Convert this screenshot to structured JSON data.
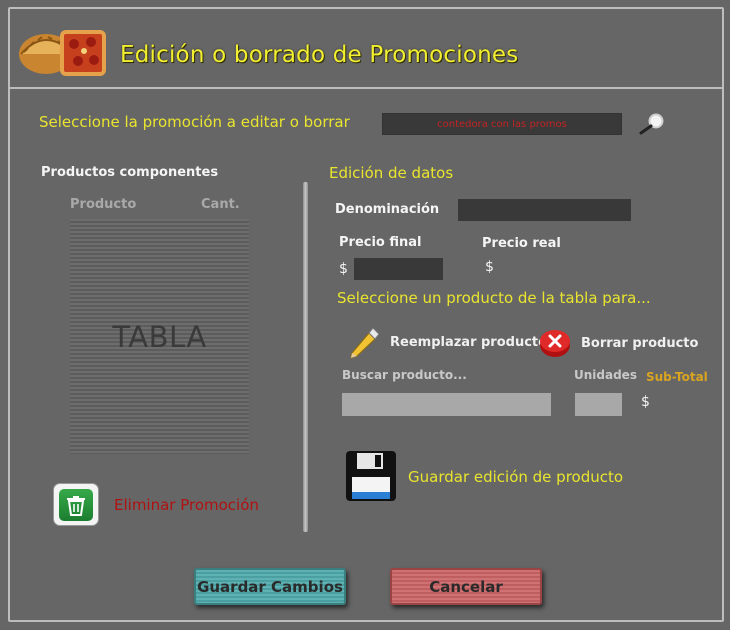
{
  "header": {
    "title": "Edición o borrado de Promociones",
    "logo": "empanada-pizza-logo"
  },
  "promo_selector": {
    "label": "Seleccione la promoción a editar o borrar",
    "value": "contedora con las promos",
    "search_icon": "magnifier-icon"
  },
  "products": {
    "title": "Productos componentes",
    "columns": [
      "Producto",
      "Cant."
    ],
    "table_placeholder": "TABLA"
  },
  "delete_promo": {
    "icon": "recycle-bin-icon",
    "label": "Eliminar Promoción"
  },
  "edit": {
    "title": "Edición de datos",
    "denominacion_label": "Denominación",
    "precio_final_label": "Precio final",
    "precio_real_label": "Precio real",
    "currency": "$",
    "select_product_label": "Seleccione un producto de la tabla para...",
    "replace_label": "Reemplazar producto",
    "delete_label": "Borrar producto",
    "buscar_label": "Buscar producto...",
    "unidades_label": "Unidades",
    "subtotal_label": "Sub-Total",
    "save_product_label": "Guardar edición de producto"
  },
  "buttons": {
    "save": "Guardar Cambios",
    "cancel": "Cancelar"
  },
  "colors": {
    "background": "#666666",
    "accent_yellow": "#e9e52e",
    "danger_red": "#b01212",
    "save_button": "#5fb2b3",
    "cancel_button": "#d07173"
  }
}
